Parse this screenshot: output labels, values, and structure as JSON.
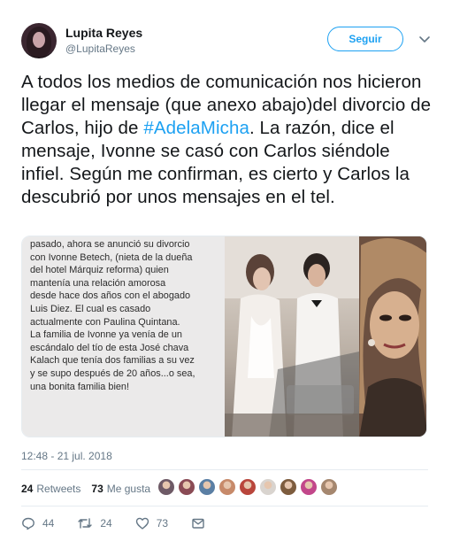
{
  "author": {
    "name": "Lupita Reyes",
    "handle": "@LupitaReyes",
    "follow_label": "Seguir"
  },
  "tweet": {
    "text_before": "A todos los medios de comunicación nos hicieron llegar el mensaje (que anexo abajo)del divorcio de Carlos, hijo de ",
    "hashtag": "#AdelaMicha",
    "text_after": ". La razón, dice el mensaje, Ivonne se casó con Carlos siéndole infiel. Según me confirman, es cierto y Carlos la descubrió por unos mensajes en el tel.",
    "media_text_lines": [
      "pasado, ahora se anunció su divorcio",
      "con Ivonne Betech, (nieta de la dueña",
      "del hotel Márquiz reforma) quien",
      "mantenía una relación amorosa",
      "desde hace dos años con el abogado",
      "Luis Diez. El cual es casado",
      "actualmente con Paulina Quintana.",
      "La familia de Ivonne ya venía de un",
      "escándalo del tío de esta José chava",
      "Kalach que tenía dos familias a su vez",
      "y se supo después de 20 años...o sea,",
      "una bonita familia bien!"
    ],
    "timestamp": "12:48 - 21 jul. 2018"
  },
  "stats": {
    "retweets_count": "24",
    "retweets_label": "Retweets",
    "likes_count": "73",
    "likes_label": "Me gusta"
  },
  "liker_colors": [
    "#6e5a66",
    "#8a4b55",
    "#5b7fa4",
    "#c78a6a",
    "#b9463c",
    "#d9d4cf",
    "#7d5c3e",
    "#c2478a",
    "#a5876f"
  ],
  "actions": {
    "reply_count": "44",
    "retweet_count": "24",
    "like_count": "73"
  },
  "icons": {
    "reply": "reply-icon",
    "retweet": "retweet-icon",
    "like": "heart-icon",
    "dm": "envelope-icon",
    "more": "chevron-down-icon"
  },
  "colors": {
    "accent": "#1da1f2",
    "secondary_text": "#657786",
    "divider": "#e6ecf0"
  }
}
